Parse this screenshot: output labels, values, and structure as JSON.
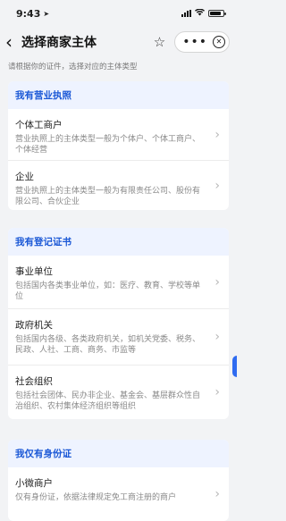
{
  "status": {
    "time": "9:43"
  },
  "nav": {
    "title": "选择商家主体"
  },
  "hint": "请根据你的证件，选择对应的主体类型",
  "sections": [
    {
      "header": "我有营业执照",
      "items": [
        {
          "title": "个体工商户",
          "desc": "营业执照上的主体类型一般为个体户、个体工商户、个体经营"
        },
        {
          "title": "企业",
          "desc": "营业执照上的主体类型一般为有限责任公司、股份有限公司、合伙企业"
        }
      ]
    },
    {
      "header": "我有登记证书",
      "items": [
        {
          "title": "事业单位",
          "desc": "包括国内各类事业单位，如：医疗、教育、学校等单位"
        },
        {
          "title": "政府机关",
          "desc": "包括国内各级、各类政府机关，如机关党委、税务、民政、人社、工商、商务、市监等"
        },
        {
          "title": "社会组织",
          "desc": "包括社会团体、民办非企业、基金会、基层群众性自治组织、农村集体经济组织等组织"
        }
      ]
    },
    {
      "header": "我仅有身份证",
      "items": [
        {
          "title": "小微商户",
          "desc": "仅有身份证，依据法律规定免工商注册的商户"
        }
      ]
    }
  ],
  "colors": {
    "accent": "#1b58d6",
    "header_bg": "#eef3ff",
    "page_bg": "#f2f3f5"
  },
  "icons": {
    "back": "chevron-left-icon",
    "favorite": "star-icon",
    "more": "more-icon",
    "close": "close-circle-icon",
    "row_arrow": "chevron-right-icon"
  }
}
